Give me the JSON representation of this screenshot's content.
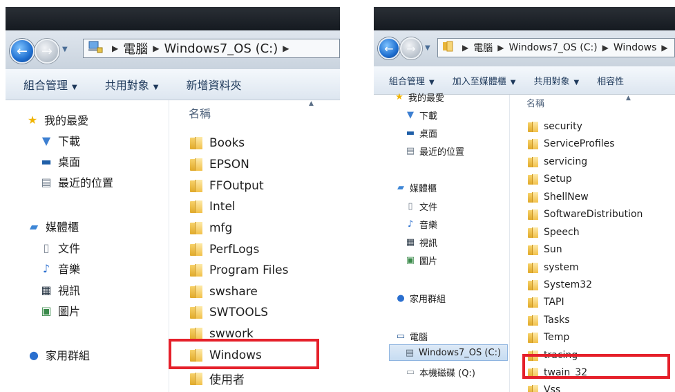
{
  "left": {
    "breadcrumbs": [
      "電腦",
      "Windows7_OS (C:)"
    ],
    "toolbar": [
      {
        "label": "組合管理",
        "caret": "▼"
      },
      {
        "label": "共用對象",
        "caret": "▼"
      },
      {
        "label": "新增資料夾",
        "caret": ""
      }
    ],
    "nav": [
      {
        "label": "我的最愛",
        "icon": "star-icon"
      },
      {
        "label": "下載",
        "icon": "download-folder-icon"
      },
      {
        "label": "桌面",
        "icon": "desktop-icon"
      },
      {
        "label": "最近的位置",
        "icon": "recent-places-icon"
      },
      {
        "label": "媒體櫃",
        "icon": "library-icon"
      },
      {
        "label": "文件",
        "icon": "documents-icon"
      },
      {
        "label": "音樂",
        "icon": "music-icon"
      },
      {
        "label": "視訊",
        "icon": "video-icon"
      },
      {
        "label": "圖片",
        "icon": "pictures-icon"
      },
      {
        "label": "家用群組",
        "icon": "homegroup-icon"
      }
    ],
    "column_header": "名稱",
    "files": [
      "Books",
      "EPSON",
      "FFOutput",
      "Intel",
      "mfg",
      "PerfLogs",
      "Program Files",
      "swshare",
      "SWTOOLS",
      "swwork",
      "Windows",
      "使用者"
    ],
    "highlighted": "Windows"
  },
  "right": {
    "breadcrumbs": [
      "電腦",
      "Windows7_OS (C:)",
      "Windows"
    ],
    "toolbar": [
      {
        "label": "組合管理",
        "caret": "▼"
      },
      {
        "label": "加入至媒體櫃",
        "caret": "▼"
      },
      {
        "label": "共用對象",
        "caret": "▼"
      },
      {
        "label": "相容性",
        "caret": ""
      }
    ],
    "nav": [
      {
        "label": "我的最愛",
        "icon": "star-icon"
      },
      {
        "label": "下載",
        "icon": "download-folder-icon"
      },
      {
        "label": "桌面",
        "icon": "desktop-icon"
      },
      {
        "label": "最近的位置",
        "icon": "recent-places-icon"
      },
      {
        "label": "媒體櫃",
        "icon": "library-icon"
      },
      {
        "label": "文件",
        "icon": "documents-icon"
      },
      {
        "label": "音樂",
        "icon": "music-icon"
      },
      {
        "label": "視訊",
        "icon": "video-icon"
      },
      {
        "label": "圖片",
        "icon": "pictures-icon"
      },
      {
        "label": "家用群組",
        "icon": "homegroup-icon"
      },
      {
        "label": "電腦",
        "icon": "computer-icon"
      },
      {
        "label": "Windows7_OS (C:)",
        "icon": "drive-c-icon"
      },
      {
        "label": "本機磁碟 (Q:)",
        "icon": "drive-q-icon"
      }
    ],
    "column_header": "名稱",
    "files": [
      "security",
      "ServiceProfiles",
      "servicing",
      "Setup",
      "ShellNew",
      "SoftwareDistribution",
      "Speech",
      "Sun",
      "system",
      "System32",
      "TAPI",
      "Tasks",
      "Temp",
      "tracing",
      "twain_32",
      "Vss"
    ],
    "highlighted": "twain_32",
    "selected_nav": "Windows7_OS (C:)"
  },
  "colors": {
    "highlight_red": "#e5202a",
    "toolbar_text": "#1e395b",
    "selection": "#cfe2f6"
  }
}
